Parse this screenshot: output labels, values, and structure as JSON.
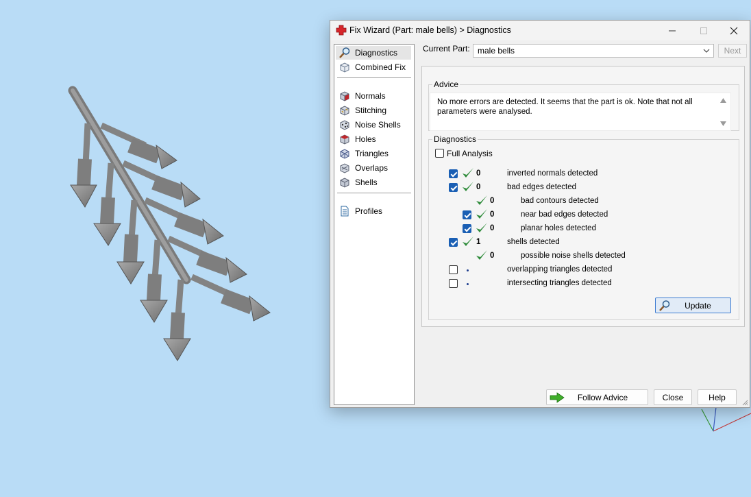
{
  "window": {
    "title": "Fix Wizard (Part: male bells) > Diagnostics",
    "app_icon": "red-cross-icon",
    "minimize_icon": "minimize-icon",
    "maximize_icon": "maximize-icon",
    "close_icon": "close-icon"
  },
  "sidebar": {
    "items": [
      {
        "label": "Diagnostics",
        "icon": "magnifier-icon",
        "selected": true
      },
      {
        "label": "Combined Fix",
        "icon": "cube-outline-icon"
      },
      {
        "label": "Normals",
        "icon": "normals-cube-icon"
      },
      {
        "label": "Stitching",
        "icon": "stitching-cube-icon"
      },
      {
        "label": "Noise Shells",
        "icon": "noise-shells-icon"
      },
      {
        "label": "Holes",
        "icon": "holes-cube-icon"
      },
      {
        "label": "Triangles",
        "icon": "triangles-cube-icon"
      },
      {
        "label": "Overlaps",
        "icon": "overlaps-cube-icon"
      },
      {
        "label": "Shells",
        "icon": "shells-cube-icon"
      },
      {
        "label": "Profiles",
        "icon": "document-icon"
      }
    ]
  },
  "part": {
    "label": "Current Part:",
    "value": "male bells",
    "next_label": "Next"
  },
  "advice": {
    "title": "Advice",
    "text": "No more errors are detected. It seems that the part is ok. Note that not all parameters were analysed."
  },
  "diagnostics": {
    "title": "Diagnostics",
    "full_analysis_label": "Full Analysis",
    "full_analysis_checked": false,
    "rows": [
      {
        "checkbox": true,
        "checked": true,
        "status": "ok",
        "count": "0",
        "label": "inverted normals detected",
        "indent": 0
      },
      {
        "checkbox": true,
        "checked": true,
        "status": "ok",
        "count": "0",
        "label": "bad edges detected",
        "indent": 0
      },
      {
        "checkbox": false,
        "checked": false,
        "status": "ok",
        "count": "0",
        "label": "bad contours detected",
        "indent": 1
      },
      {
        "checkbox": true,
        "checked": true,
        "status": "ok",
        "count": "0",
        "label": "near bad edges detected",
        "indent": 1
      },
      {
        "checkbox": true,
        "checked": true,
        "status": "ok",
        "count": "0",
        "label": "planar holes detected",
        "indent": 1
      },
      {
        "checkbox": true,
        "checked": true,
        "status": "ok",
        "count": "1",
        "label": "shells detected",
        "indent": 0
      },
      {
        "checkbox": false,
        "checked": false,
        "status": "ok",
        "count": "0",
        "label": "possible noise shells detected",
        "indent": 1
      },
      {
        "checkbox": true,
        "checked": false,
        "status": "none",
        "count": "",
        "label": "overlapping triangles detected",
        "indent": 0
      },
      {
        "checkbox": true,
        "checked": false,
        "status": "none",
        "count": "",
        "label": "intersecting triangles detected",
        "indent": 0
      }
    ],
    "update_label": "Update"
  },
  "footer": {
    "follow_advice_label": "Follow Advice",
    "close_label": "Close",
    "help_label": "Help"
  },
  "colors": {
    "viewport_background": "#b9dcf6",
    "check_green": "#2e8b3a",
    "checkbox_blue": "#1a5fb4",
    "model_gray": "#8f8f8f"
  }
}
